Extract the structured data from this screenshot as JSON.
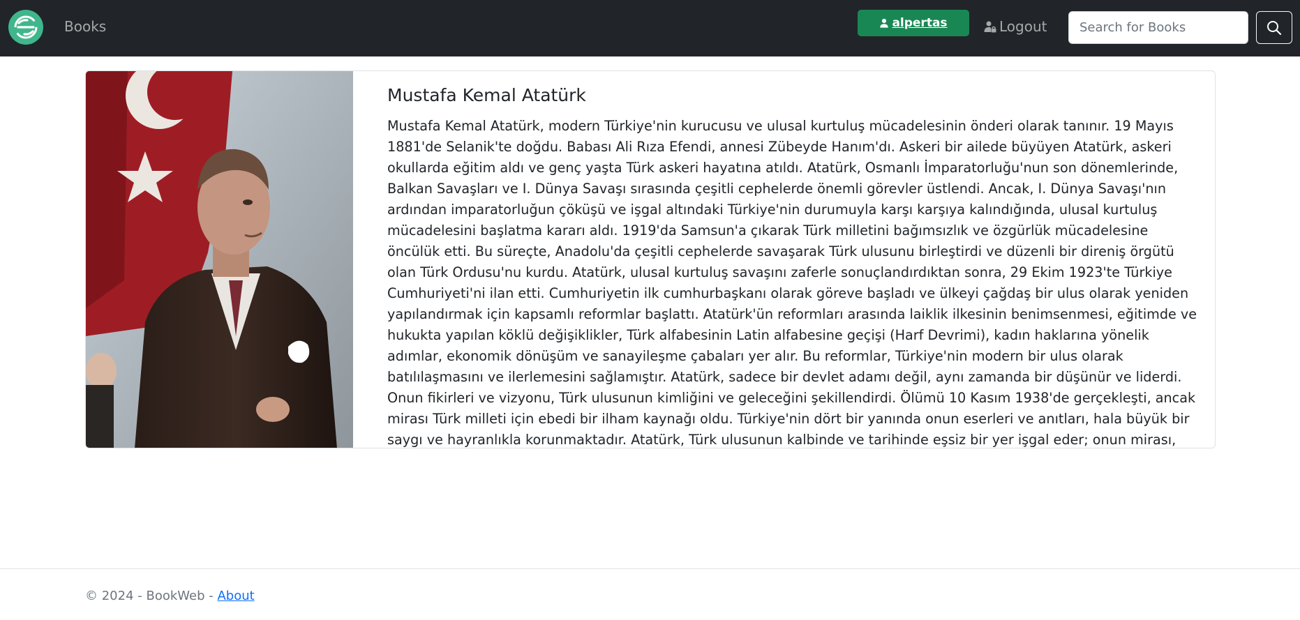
{
  "navbar": {
    "brand_icon": "brand-logo-icon",
    "books_link": "Books",
    "user_label": "alpertas",
    "logout_label": "Logout",
    "search_placeholder": "Search for Books"
  },
  "author": {
    "name": "Mustafa Kemal Atatürk",
    "biography": "Mustafa Kemal Atatürk, modern Türkiye'nin kurucusu ve ulusal kurtuluş mücadelesinin önderi olarak tanınır. 19 Mayıs 1881'de Selanik'te doğdu. Babası Ali Rıza Efendi, annesi Zübeyde Hanım'dı. Askeri bir ailede büyüyen Atatürk, askeri okullarda eğitim aldı ve genç yaşta Türk askeri hayatına atıldı. Atatürk, Osmanlı İmparatorluğu'nun son dönemlerinde, Balkan Savaşları ve I. Dünya Savaşı sırasında çeşitli cephelerde önemli görevler üstlendi. Ancak, I. Dünya Savaşı'nın ardından imparatorluğun çöküşü ve işgal altındaki Türkiye'nin durumuyla karşı karşıya kalındığında, ulusal kurtuluş mücadelesini başlatma kararı aldı. 1919'da Samsun'a çıkarak Türk milletini bağımsızlık ve özgürlük mücadelesine öncülük etti. Bu süreçte, Anadolu'da çeşitli cephelerde savaşarak Türk ulusunu birleştirdi ve düzenli bir direniş örgütü olan Türk Ordusu'nu kurdu. Atatürk, ulusal kurtuluş savaşını zaferle sonuçlandırdıktan sonra, 29 Ekim 1923'te Türkiye Cumhuriyeti'ni ilan etti. Cumhuriyetin ilk cumhurbaşkanı olarak göreve başladı ve ülkeyi çağdaş bir ulus olarak yeniden yapılandırmak için kapsamlı reformlar başlattı. Atatürk'ün reformları arasında laiklik ilkesinin benimsenmesi, eğitimde ve hukukta yapılan köklü değişiklikler, Türk alfabesinin Latin alfabesine geçişi (Harf Devrimi), kadın haklarına yönelik adımlar, ekonomik dönüşüm ve sanayileşme çabaları yer alır. Bu reformlar, Türkiye'nin modern bir ulus olarak batılılaşmasını ve ilerlemesini sağlamıştır. Atatürk, sadece bir devlet adamı değil, aynı zamanda bir düşünür ve liderdi. Onun fikirleri ve vizyonu, Türk ulusunun kimliğini ve geleceğini şekillendirdi. Ölümü 10 Kasım 1938'de gerçekleşti, ancak mirası Türk milleti için ebedi bir ilham kaynağı oldu. Türkiye'nin dört bir yanında onun eserleri ve anıtları, hala büyük bir saygı ve hayranlıkla korunmaktadır. Atatürk, Türk ulusunun kalbinde ve tarihinde eşsiz bir yer işgal eder; onun mirası, Türkiye'nin modern kimliğinin temel taşlarından biridir."
  },
  "footer": {
    "copyright": "© 2024 - BookWeb - ",
    "about_link": "About"
  },
  "colors": {
    "navbar_bg": "#212529",
    "user_button": "#198754",
    "brand_logo": "#3fb68b",
    "link": "#0d6efd"
  }
}
